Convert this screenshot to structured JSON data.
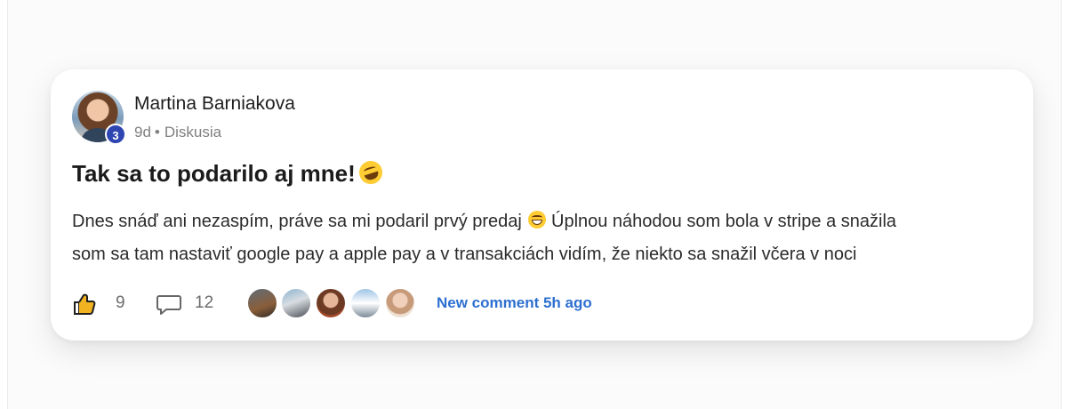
{
  "post": {
    "author": "Martina Barniakova",
    "level_badge": "3",
    "time": "9d",
    "separator": "•",
    "category": "Diskusia",
    "title": "Tak sa to podarilo aj mne!",
    "title_emoji": "rolling-on-floor-laughing-emoji",
    "body_line1_before": "Dnes snáď ani nezaspím, práve sa mi podaril prvý predaj",
    "body_emoji": "grinning-face-emoji",
    "body_line1_after": "Úplnou náhodou som bola v stripe a snažila",
    "body_line2": "som sa tam nastaviť google pay a apple pay a v transakciách vidím, že niekto sa snažil včera v noci"
  },
  "footer": {
    "likes": "9",
    "comments": "12",
    "new_comment": "New comment 5h ago",
    "like_icon": "thumbs-up-icon",
    "comment_icon": "comment-bubble-icon"
  },
  "colors": {
    "badge": "#2f46b2",
    "link": "#2d6fd0",
    "text": "#2b2b2b",
    "muted": "#808080"
  }
}
